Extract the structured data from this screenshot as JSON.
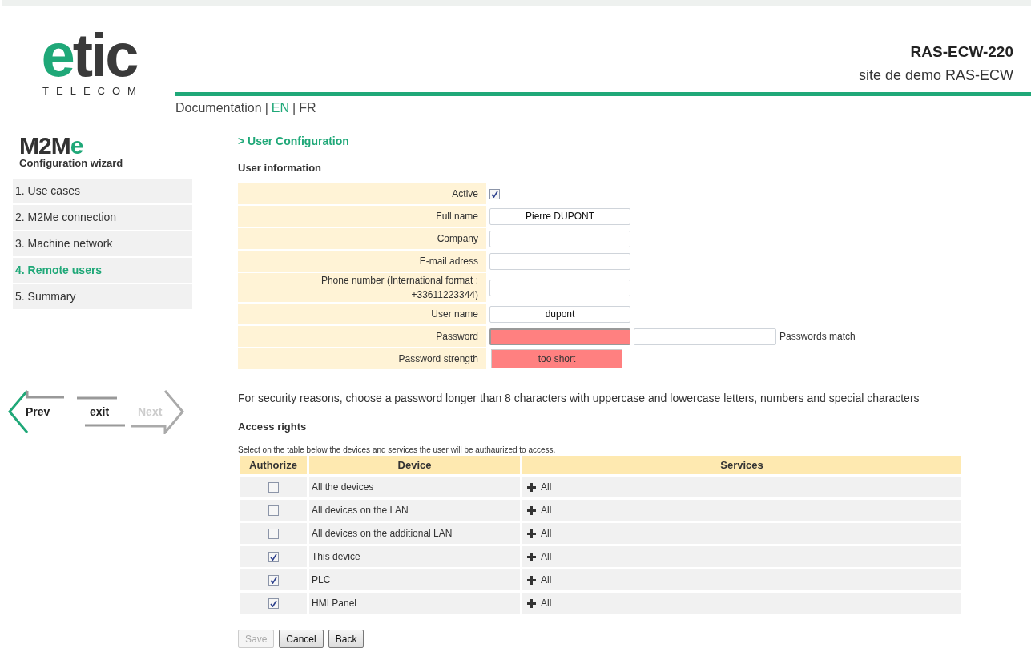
{
  "header": {
    "logo_word": "etic",
    "logo_sub": "TELECOM",
    "device": "RAS-ECW-220",
    "site": "site de demo RAS-ECW",
    "link_separator": "|",
    "links": [
      {
        "label": "Documentation",
        "selected": false
      },
      {
        "label": "EN",
        "selected": true
      },
      {
        "label": "FR",
        "selected": false
      }
    ]
  },
  "sidebar": {
    "product": "M2Me",
    "subtitle": "Configuration wizard",
    "steps": [
      {
        "label": "1. Use cases",
        "selected": false
      },
      {
        "label": "2. M2Me connection",
        "selected": false
      },
      {
        "label": "3. Machine network",
        "selected": false
      },
      {
        "label": "4. Remote users",
        "selected": true
      },
      {
        "label": "5. Summary",
        "selected": false
      }
    ],
    "nav": [
      {
        "kind": "prev",
        "label": "Prev",
        "disabled": false
      },
      {
        "kind": "exit",
        "label": "exit",
        "disabled": false
      },
      {
        "kind": "next",
        "label": "Next",
        "disabled": true
      }
    ]
  },
  "page_title": "> User Configuration",
  "user_info": {
    "heading": "User information",
    "rows": [
      {
        "kind": "checkbox",
        "label": "Active",
        "checked": true
      },
      {
        "kind": "text",
        "label": "Full name",
        "value": "Pierre DUPONT"
      },
      {
        "kind": "text",
        "label": "Company"
      },
      {
        "kind": "text",
        "label": "E-mail adress"
      },
      {
        "kind": "text",
        "label": "Phone number (International format : +33611223344)"
      },
      {
        "kind": "text",
        "label": "User name",
        "value": "dupont"
      },
      {
        "kind": "password",
        "label": "Password",
        "invalid": true,
        "match_text": "Passwords match"
      },
      {
        "kind": "meter",
        "label": "Password strength",
        "text": "too short",
        "invalid": true
      }
    ]
  },
  "security_note": "For security reasons, choose a password longer than 8 characters with uppercase and lowercase letters, numbers and special characters",
  "access": {
    "heading": "Access rights",
    "hint": "Select on the table below the devices and services the user will be authaurized to access.",
    "columns": [
      "Authorize",
      "Device",
      "Services"
    ],
    "rows": [
      {
        "checked": false,
        "device": "All the devices",
        "services": "All"
      },
      {
        "checked": false,
        "device": "All devices on the LAN",
        "services": "All"
      },
      {
        "checked": false,
        "device": "All devices on the additional LAN",
        "services": "All"
      },
      {
        "checked": true,
        "device": "This device",
        "services": "All"
      },
      {
        "checked": true,
        "device": "PLC",
        "services": "All"
      },
      {
        "checked": true,
        "device": "HMI Panel",
        "services": "All"
      }
    ]
  },
  "buttons": [
    {
      "label": "Save",
      "disabled": true
    },
    {
      "label": "Cancel",
      "disabled": false
    },
    {
      "label": "Back",
      "disabled": false
    }
  ]
}
